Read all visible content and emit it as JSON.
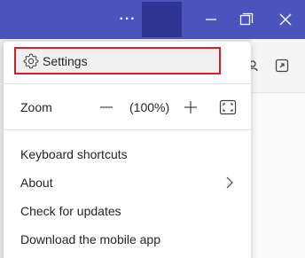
{
  "titlebar": {
    "more_label": "···",
    "colors": {
      "bar": "#4b53bc",
      "avatar": "#2f3593"
    }
  },
  "menu": {
    "settings_label": "Settings",
    "zoom": {
      "label": "Zoom",
      "value": "(100%)"
    },
    "items": [
      {
        "label": "Keyboard shortcuts"
      },
      {
        "label": "About",
        "has_submenu": true
      },
      {
        "label": "Check for updates"
      },
      {
        "label": "Download the mobile app"
      }
    ],
    "highlight_color": "#d81e2a"
  },
  "icons": {
    "more": "more-horizontal-icon",
    "minimize": "minimize-icon",
    "maximize": "maximize-icon",
    "close": "close-icon",
    "settings": "gear-icon",
    "zoom_out": "minus-icon",
    "zoom_in": "plus-icon",
    "fullscreen": "fullscreen-icon",
    "submenu": "chevron-right-icon"
  }
}
